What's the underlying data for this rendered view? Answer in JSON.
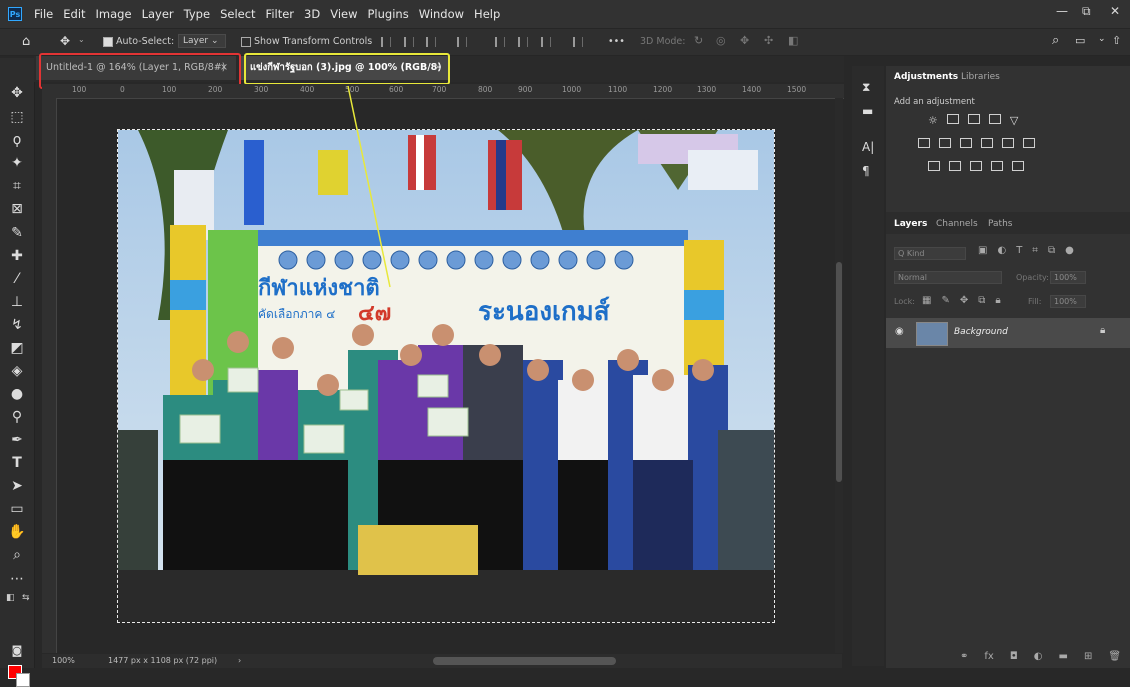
{
  "app": {
    "logo": "Ps",
    "menu": [
      "File",
      "Edit",
      "Image",
      "Layer",
      "Type",
      "Select",
      "Filter",
      "3D",
      "View",
      "Plugins",
      "Window",
      "Help"
    ],
    "window_controls": [
      "—",
      "⧉",
      "✕"
    ]
  },
  "options_bar": {
    "auto_select_label": "Auto-Select:",
    "auto_select_checked": true,
    "auto_select_target": "Layer",
    "show_transform_label": "Show Transform Controls",
    "more": "•••",
    "mode_3d": "3D Mode:"
  },
  "tabs": [
    {
      "label": "Untitled-1 @ 164% (Layer 1, RGB/8#)",
      "close": "×",
      "active": false
    },
    {
      "label": "แข่งกีฬารัฐบอก (3).jpg @ 100% (RGB/8)",
      "close": "×",
      "active": true
    }
  ],
  "ruler": {
    "horizontal_ticks": [
      "100",
      "0",
      "100",
      "200",
      "300",
      "400",
      "500",
      "600",
      "700",
      "800",
      "900",
      "1000",
      "1100",
      "1200",
      "1300",
      "1400",
      "1500"
    ]
  },
  "canvas": {
    "photo_banner_text_1": "กีฬาแห่งชาติ",
    "photo_banner_text_2": "ระนองเกมส์",
    "photo_banner_text_3": "๔๗",
    "photo_banner_text_4": "คัดเลือกภาค ๔"
  },
  "panels": {
    "adjustments": {
      "tabs": [
        "Adjustments",
        "Libraries"
      ],
      "add_label": "Add an adjustment"
    },
    "layers": {
      "tabs": [
        "Layers",
        "Channels",
        "Paths"
      ],
      "kind_placeholder": "Q Kind",
      "blend_mode": "Normal",
      "opacity_label": "Opacity:",
      "opacity_value": "100%",
      "lock_label": "Lock:",
      "fill_label": "Fill:",
      "fill_value": "100%",
      "layer_items": [
        {
          "name": "Background",
          "visible": true,
          "locked": true
        }
      ]
    }
  },
  "status": {
    "zoom": "100%",
    "doc_info": "1477 px x 1108 px (72 ppi)"
  },
  "colors": {
    "foreground": "#ff0000",
    "background": "#ffffff",
    "highlight_red": "#e23434",
    "highlight_yellow": "#e8e83a"
  }
}
